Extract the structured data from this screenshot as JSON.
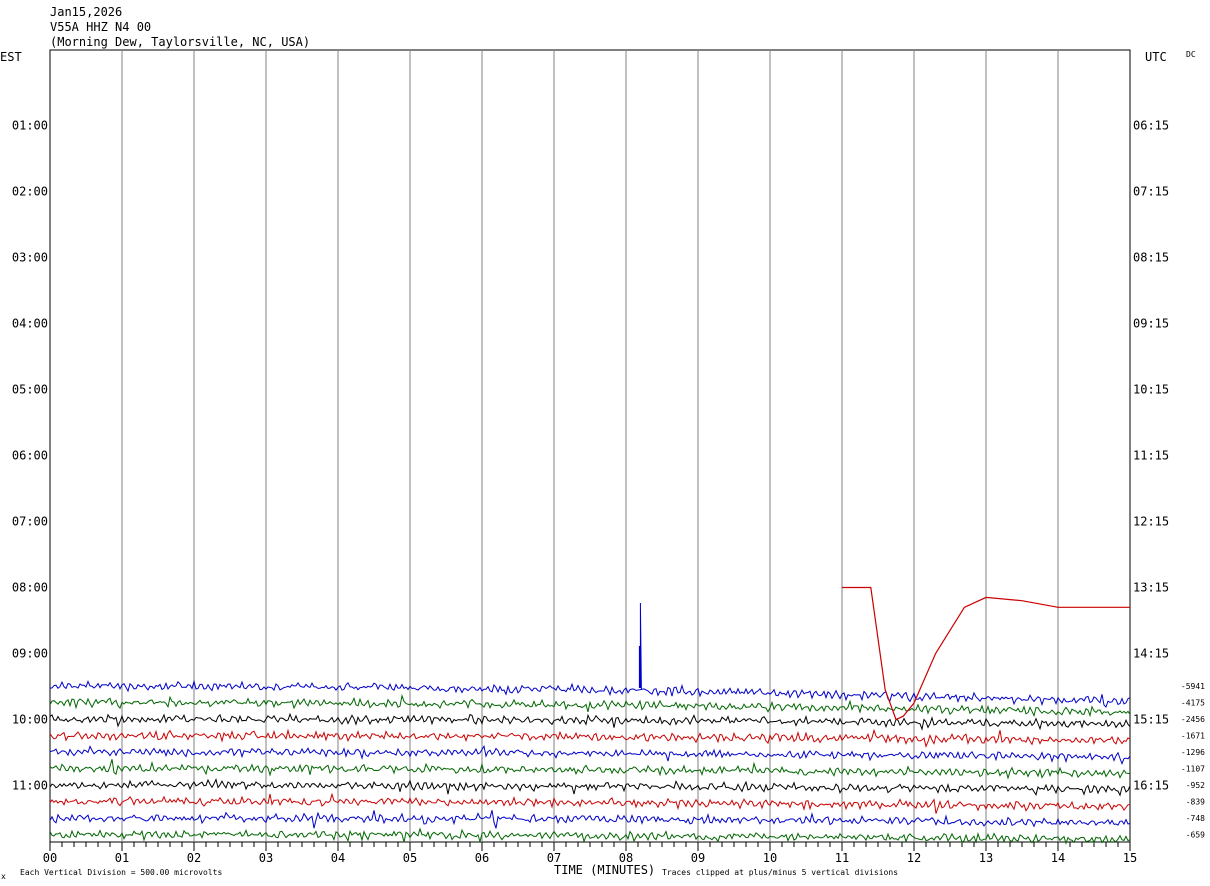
{
  "header": {
    "date": "Jan15,2026",
    "station": "V55A HHZ N4 00",
    "location": "(Morning Dew, Taylorsville, NC, USA)",
    "left_tz": "EST",
    "right_tz": "UTC",
    "dc_label": "DC"
  },
  "footer": {
    "scale_note": "Each Vertical Division =  500.00 microvolts",
    "x_label": "TIME (MINUTES)",
    "clip_note": "Traces clipped at plus/minus 5 vertical divisions",
    "corner_mark": "x"
  },
  "chart_data": {
    "type": "line",
    "title": "V55A HHZ N4 00",
    "xlabel": "TIME (MINUTES)",
    "xlim": [
      0,
      15
    ],
    "x_ticks": [
      "00",
      "01",
      "02",
      "03",
      "04",
      "05",
      "06",
      "07",
      "08",
      "09",
      "10",
      "11",
      "12",
      "13",
      "14",
      "15"
    ],
    "left_hour_labels": [
      "01:00",
      "02:00",
      "03:00",
      "04:00",
      "05:00",
      "06:00",
      "07:00",
      "08:00",
      "09:00",
      "10:00",
      "11:00"
    ],
    "right_hour_labels": [
      "06:15",
      "07:15",
      "08:15",
      "09:15",
      "10:15",
      "11:15",
      "12:15",
      "13:15",
      "14:15",
      "15:15",
      "16:15"
    ],
    "grid": "vertical lines every minute",
    "trace_colors": [
      "#0000cc",
      "#006600",
      "#000000",
      "#cc0000"
    ],
    "traces": [
      {
        "offset": "-5941",
        "color": "#0000cc"
      },
      {
        "offset": "-4175",
        "color": "#006600"
      },
      {
        "offset": "-2456",
        "color": "#000000"
      },
      {
        "offset": "-1671",
        "color": "#cc0000"
      },
      {
        "offset": "-1296",
        "color": "#0000cc"
      },
      {
        "offset": "-1107",
        "color": "#006600"
      },
      {
        "offset": "-952",
        "color": "#000000"
      },
      {
        "offset": "-839",
        "color": "#cc0000"
      },
      {
        "offset": "-748",
        "color": "#0000cc"
      },
      {
        "offset": "-659",
        "color": "#006600"
      }
    ],
    "red_dc_trace": {
      "color": "#cc0000",
      "x": [
        11.0,
        11.4,
        11.6,
        11.75,
        11.85,
        12.0,
        12.3,
        12.7,
        13.0,
        13.5,
        14.0,
        15.0
      ],
      "level": [
        8.0,
        8.0,
        9.55,
        10.0,
        9.95,
        9.75,
        9.0,
        8.3,
        8.15,
        8.2,
        8.3,
        8.3
      ]
    },
    "spike": {
      "x": 8.2,
      "color": "#0000cc"
    }
  }
}
